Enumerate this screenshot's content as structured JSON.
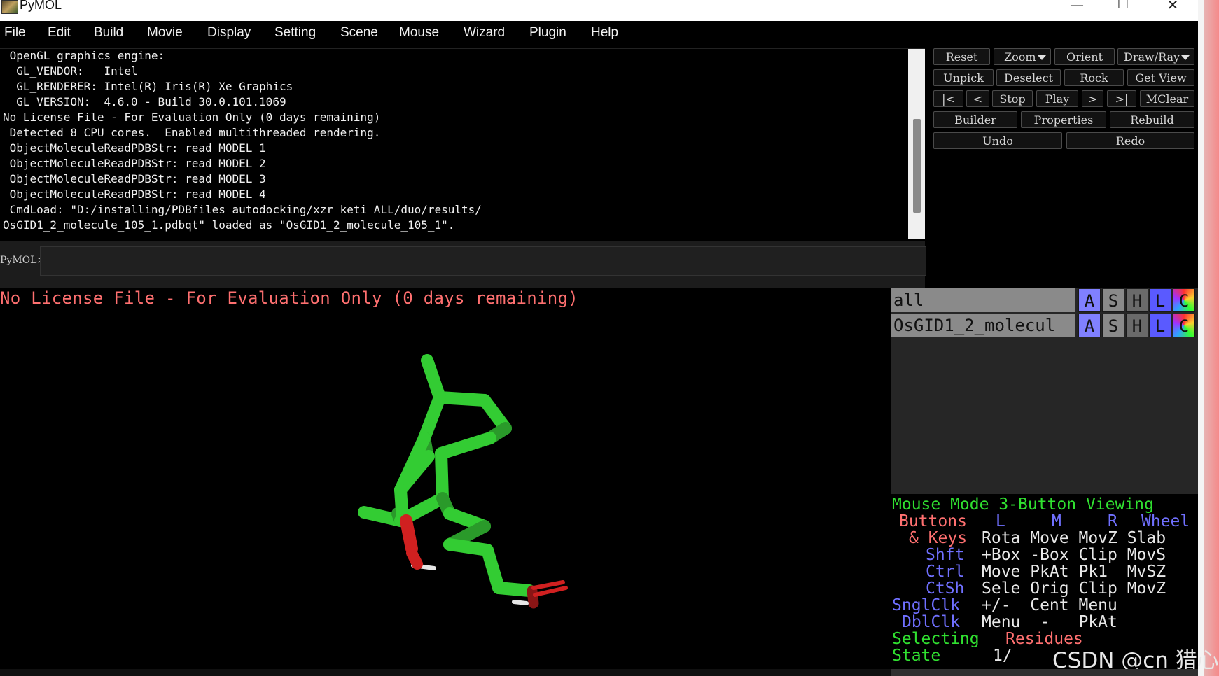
{
  "window": {
    "title": "PyMOL",
    "controls": [
      "—",
      "☐",
      "✕"
    ]
  },
  "menubar": [
    "File",
    "Edit",
    "Build",
    "Movie",
    "Display",
    "Setting",
    "Scene",
    "Mouse",
    "Wizard",
    "Plugin",
    "Help"
  ],
  "log": [
    " OpenGL graphics engine:",
    "  GL_VENDOR:   Intel",
    "  GL_RENDERER: Intel(R) Iris(R) Xe Graphics",
    "  GL_VERSION:  4.6.0 - Build 30.0.101.1069",
    "No License File - For Evaluation Only (0 days remaining)",
    " Detected 8 CPU cores.  Enabled multithreaded rendering.",
    " ObjectMoleculeReadPDBStr: read MODEL 1",
    " ObjectMoleculeReadPDBStr: read MODEL 2",
    " ObjectMoleculeReadPDBStr: read MODEL 3",
    " ObjectMoleculeReadPDBStr: read MODEL 4",
    " CmdLoad: \"D:/installing/PDBfiles_autodocking/xzr_keti_ALL/duo/results/",
    "OsGID1_2_molecule_105_1.pdbqt\" loaded as \"OsGID1_2_molecule_105_1\"."
  ],
  "command": {
    "prompt": "PyMOL>",
    "value": ""
  },
  "buttons": {
    "reset": "Reset",
    "zoom": "Zoom",
    "orient": "Orient",
    "drawray": "Draw/Ray",
    "unpick": "Unpick",
    "deselect": "Deselect",
    "rock": "Rock",
    "getview": "Get View",
    "first": "|<",
    "prev": "<",
    "stop": "Stop",
    "play": "Play",
    "next": ">",
    "last": ">|",
    "mclear": "MClear",
    "builder": "Builder",
    "properties": "Properties",
    "rebuild": "Rebuild",
    "undo": "Undo",
    "redo": "Redo"
  },
  "viewer": {
    "license_msg": "No License File - For Evaluation Only (0 days remaining)"
  },
  "objects": [
    {
      "name": "all",
      "flags": [
        "A",
        "S",
        "H",
        "L",
        "C"
      ]
    },
    {
      "name": "OsGID1_2_molecul",
      "flags": [
        "A",
        "S",
        "H",
        "L",
        "C"
      ]
    }
  ],
  "mouse_mode": {
    "title": "Mouse Mode 3-Button Viewing",
    "buttons_label": "Buttons",
    "col_l": "L",
    "col_m": "M",
    "col_r": "R",
    "col_wheel": "Wheel",
    "rows": [
      {
        "key": "& Keys",
        "vals": "Rota Move MovZ Slab"
      },
      {
        "key": "Shft",
        "vals": "+Box -Box Clip MovS"
      },
      {
        "key": "Ctrl",
        "vals": "Move PkAt Pk1  MvSZ"
      },
      {
        "key": "CtSh",
        "vals": "Sele Orig Clip MovZ"
      },
      {
        "key": "SnglClk",
        "vals": "+/-  Cent Menu"
      },
      {
        "key": "DblClk",
        "vals": "Menu  -   PkAt"
      }
    ],
    "selecting_label": "Selecting",
    "selecting_value": "Residues",
    "state_label": "State",
    "state_value": "1/"
  },
  "watermark": "CSDN @cn 猎心",
  "colors": {
    "carbon": "#33cc33",
    "oxygen": "#e02020",
    "hydrogen": "#e6e6e6",
    "license_text": "#ff7070"
  }
}
